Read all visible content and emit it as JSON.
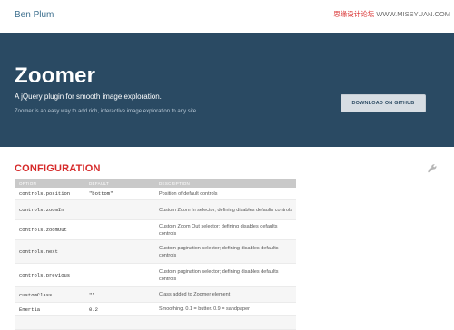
{
  "header": {
    "brand": "Ben Plum",
    "watermark_red": "思缘设计论坛",
    "watermark_rest": " WWW.MISSYUAN.COM"
  },
  "hero": {
    "title": "Zoomer",
    "tagline": "A jQuery plugin for smooth image exploration.",
    "description": "Zoomer is an easy way to add rich, interactive image exploration to any site.",
    "github_button": "DOWNLOAD ON GITHUB",
    "background": "#2a4a63"
  },
  "configuration": {
    "title": "CONFIGURATION",
    "title_color": "#d62a2a",
    "icon": "wrench-icon",
    "columns": [
      "OPTION",
      "DEFAULT",
      "DESCRIPTION"
    ],
    "rows": [
      {
        "option": "controls.position",
        "default": "\"bottom\"",
        "description": "Position of default controls"
      },
      {
        "option": "controls.zoomIn",
        "default": "",
        "description": "Custom Zoom In selector; defining disables defaults controls"
      },
      {
        "option": "controls.zoomOut",
        "default": "",
        "description": "Custom Zoom Out selector; defining disables defaults controls"
      },
      {
        "option": "controls.next",
        "default": "",
        "description": "Custom pagination selector; defining disables defaults controls"
      },
      {
        "option": "controls.previous",
        "default": "",
        "description": "Custom pagination selector; defining disables defaults controls"
      },
      {
        "option": "customClass",
        "default": "\"\"",
        "description": "Class added to Zoomer element"
      },
      {
        "option": "Enertia",
        "default": "0.2",
        "description": "Smoothing. 0.1 = butter. 0.9 = sandpaper"
      },
      {
        "option": "",
        "default": "",
        "description": ""
      }
    ]
  }
}
